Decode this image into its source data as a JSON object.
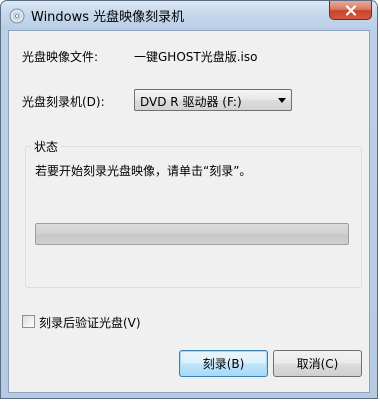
{
  "window": {
    "title": "Windows 光盘映像刻录机",
    "close_icon": "close-icon",
    "accent_color": "#c7432b"
  },
  "image_file": {
    "label": "光盘映像文件:",
    "value": "一键GHOST光盘版.iso"
  },
  "burner": {
    "label": "光盘刻录机(D):",
    "selected": "DVD R 驱动器 (F:)"
  },
  "status": {
    "group_title": "状态",
    "message": "若要开始刻录光盘映像，请单击“刻录”。",
    "progress_percent": 0
  },
  "verify": {
    "label": "刻录后验证光盘(V)",
    "checked": false
  },
  "buttons": {
    "burn": "刻录(B)",
    "cancel": "取消(C)"
  }
}
